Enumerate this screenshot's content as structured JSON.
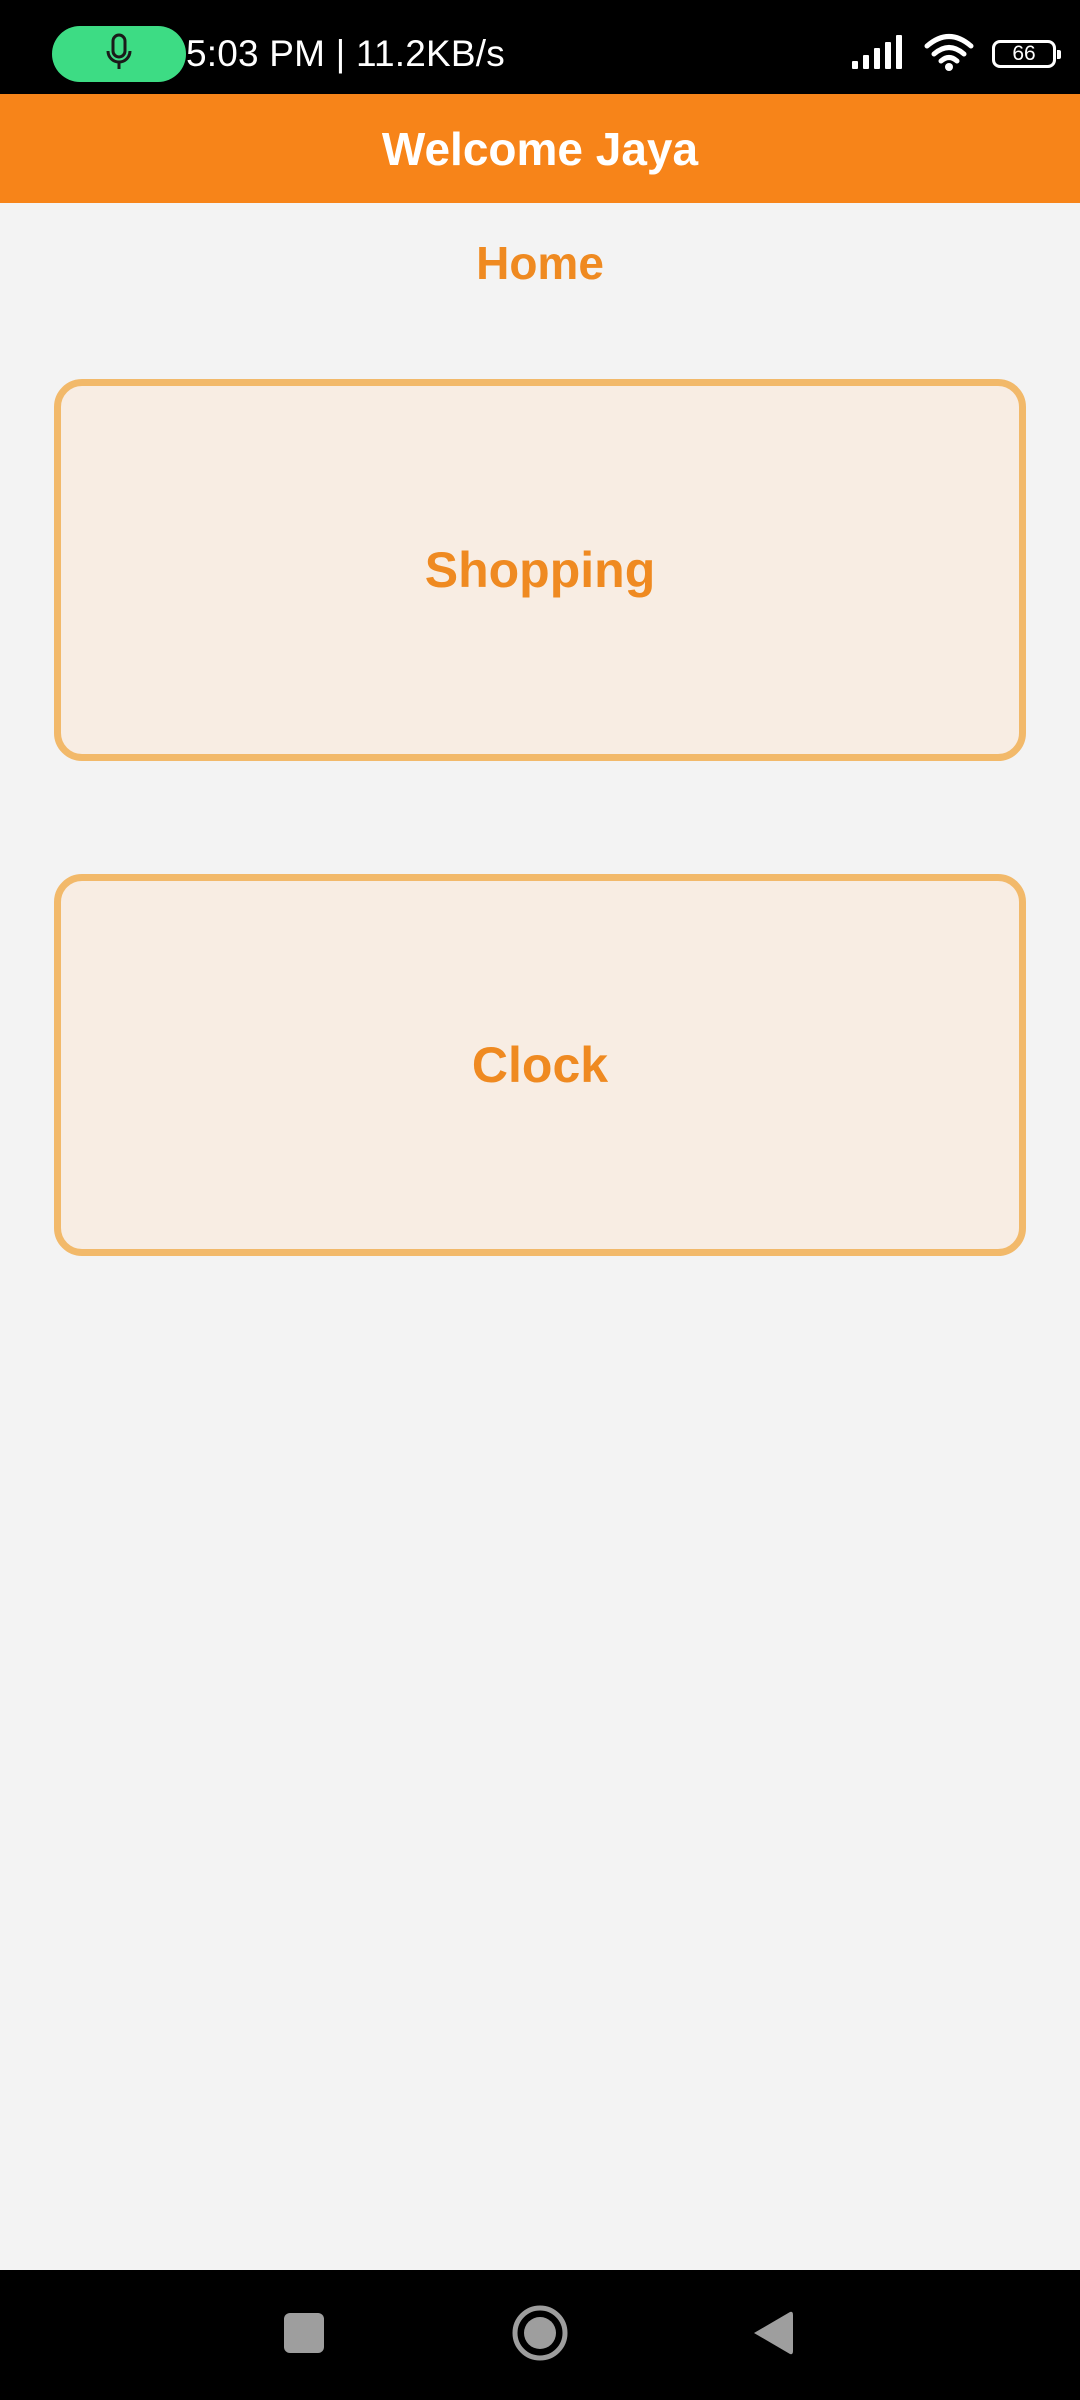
{
  "status_bar": {
    "time_speed": "5:03 PM | 11.2KB/s",
    "battery_level": "66",
    "icons": [
      "mic-icon",
      "signal-icon",
      "wifi-icon",
      "battery-icon"
    ]
  },
  "app_bar": {
    "title": "Welcome Jaya"
  },
  "page": {
    "heading": "Home"
  },
  "tiles": [
    {
      "label": "Shopping"
    },
    {
      "label": "Clock"
    }
  ],
  "nav_bar": {
    "icons": [
      "recents-icon",
      "home-icon",
      "back-icon"
    ]
  },
  "colors": {
    "accent": "#f78419",
    "text_accent": "#ef8a21",
    "tile_border": "#f2b96a",
    "tile_fill": "#f8ede3",
    "background": "#f3f3f3",
    "mic_pill": "#3ddc84"
  }
}
